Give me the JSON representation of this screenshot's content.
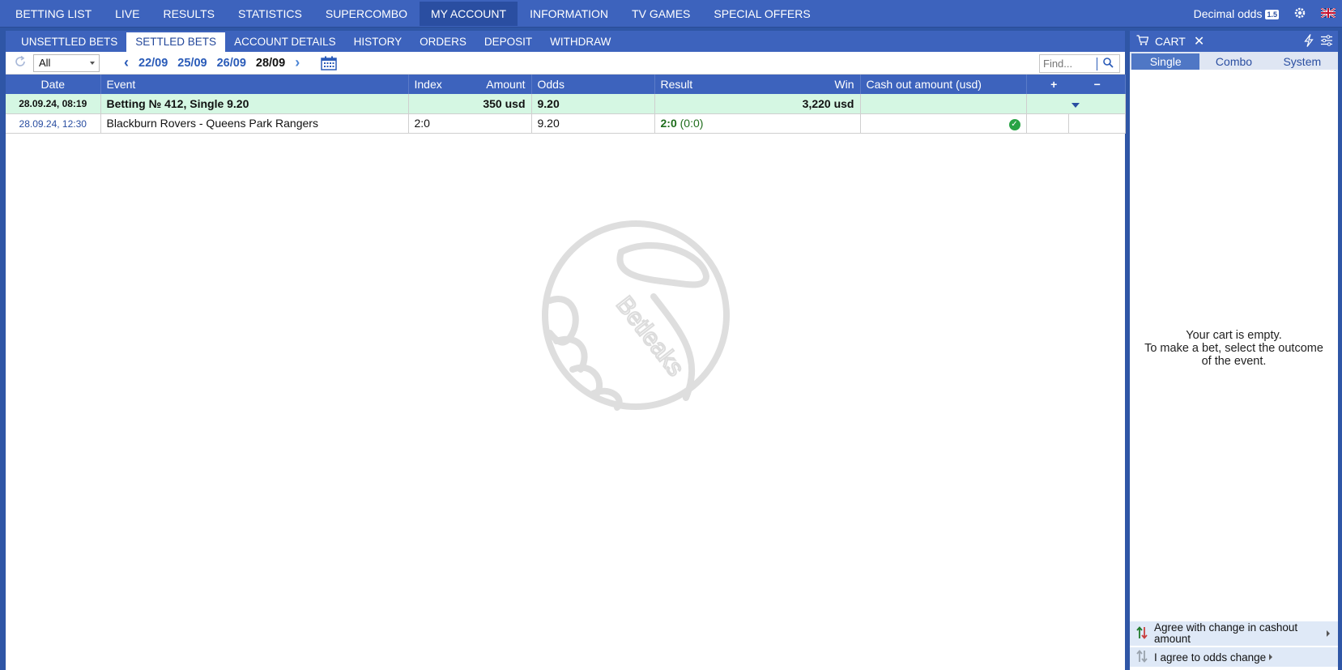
{
  "topnav": {
    "items": [
      "BETTING LIST",
      "LIVE",
      "RESULTS",
      "STATISTICS",
      "SUPERCOMBO",
      "MY ACCOUNT",
      "INFORMATION",
      "TV GAMES",
      "SPECIAL OFFERS"
    ],
    "active": "MY ACCOUNT",
    "odds_label": "Decimal odds",
    "odds_badge": "1.5"
  },
  "subnav": {
    "items": [
      "UNSETTLED BETS",
      "SETTLED BETS",
      "ACCOUNT DETAILS",
      "HISTORY",
      "ORDERS",
      "DEPOSIT",
      "WITHDRAW"
    ],
    "active": "SETTLED BETS"
  },
  "toolbar": {
    "filter_value": "All",
    "dates": [
      "22/09",
      "25/09",
      "26/09",
      "28/09"
    ],
    "current_date": "28/09",
    "search_placeholder": "Find..."
  },
  "table": {
    "headers": {
      "date": "Date",
      "event": "Event",
      "index": "Index",
      "amount": "Amount",
      "odds": "Odds",
      "result": "Result",
      "win": "Win",
      "cashout": "Cash out amount (usd)",
      "plus": "+",
      "minus": "−"
    },
    "summary": {
      "date": "28.09.24,  08:19",
      "event": "Betting № 412, Single 9.20",
      "amount": "350 usd",
      "odds": "9.20",
      "win": "3,220 usd"
    },
    "detail": {
      "date": "28.09.24, 12:30",
      "event": "Blackburn Rovers - Queens Park Rangers",
      "index": "2:0",
      "odds": "9.20",
      "score": "2:0",
      "halftime": "(0:0)"
    }
  },
  "watermark": "Betleaks",
  "cart": {
    "title": "CART",
    "tabs": [
      "Single",
      "Combo",
      "System"
    ],
    "active_tab": "Single",
    "empty_line1": "Your cart is empty.",
    "empty_line2": "To make a bet, select the outcome",
    "empty_line3": "of the event.",
    "agree_cashout": "Agree with change in cashout amount",
    "agree_odds": "I agree to odds change"
  }
}
